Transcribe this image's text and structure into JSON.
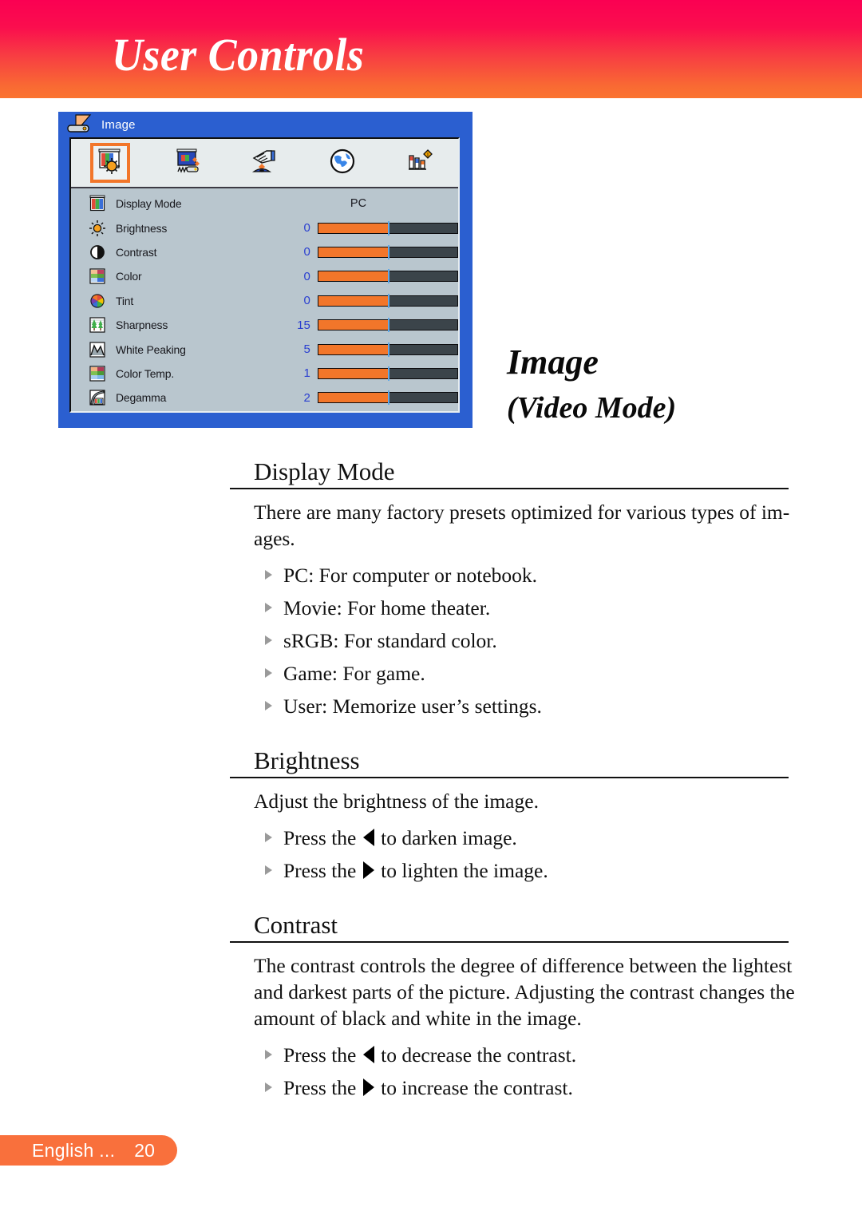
{
  "header": {
    "title": "User Controls",
    "gradient_top": "#fa0052",
    "gradient_bottom": "#fb7330"
  },
  "osd": {
    "window_title": "Image",
    "titlebar_icon": "projector-icon",
    "accent_color": "#f2762a",
    "frame_color": "#2b5fd0",
    "panel_color": "#b9c6ce",
    "tabs": [
      {
        "name": "image-tab",
        "icon": "image-screen-brightness-icon",
        "selected": true
      },
      {
        "name": "display-tab",
        "icon": "display-projector-icon",
        "selected": false
      },
      {
        "name": "setup-tab",
        "icon": "setup-hand-icon",
        "selected": false
      },
      {
        "name": "language-tab",
        "icon": "globe-icon",
        "selected": false
      },
      {
        "name": "options-tab",
        "icon": "bar-chart-info-icon",
        "selected": false
      }
    ],
    "rows": [
      {
        "icon": "rgb-bars-icon",
        "label": "Display Mode",
        "value_text": "PC",
        "has_slider": false
      },
      {
        "icon": "sun-icon",
        "label": "Brightness",
        "value": "0",
        "has_slider": true,
        "fill_percent": 50
      },
      {
        "icon": "contrast-icon",
        "label": "Contrast",
        "value": "0",
        "has_slider": true,
        "fill_percent": 50
      },
      {
        "icon": "color-swatch-icon",
        "label": "Color",
        "value": "0",
        "has_slider": true,
        "fill_percent": 50
      },
      {
        "icon": "color-wheel-icon",
        "label": "Tint",
        "value": "0",
        "has_slider": true,
        "fill_percent": 50
      },
      {
        "icon": "trees-icon",
        "label": "Sharpness",
        "value": "15",
        "has_slider": true,
        "fill_percent": 50
      },
      {
        "icon": "waveform-icon",
        "label": "White Peaking",
        "value": "5",
        "has_slider": true,
        "fill_percent": 50
      },
      {
        "icon": "color-temp-icon",
        "label": "Color Temp.",
        "value": "1",
        "has_slider": true,
        "fill_percent": 50
      },
      {
        "icon": "degamma-icon",
        "label": "Degamma",
        "value": "2",
        "has_slider": true,
        "fill_percent": 50
      }
    ]
  },
  "page": {
    "heading": "Image",
    "subheading": "(Video Mode)"
  },
  "sections": [
    {
      "heading": "Display Mode",
      "paragraph": "There are many factory presets optimized for various types of im-ages.",
      "bullets": [
        "PC: For computer or notebook.",
        "Movie: For home theater.",
        "sRGB: For standard color.",
        "Game: For game.",
        "User: Memorize user’s settings."
      ]
    },
    {
      "heading": "Brightness",
      "paragraph": "Adjust the brightness of the image.",
      "arrow_bullets": [
        {
          "prefix": "Press the",
          "arrow": "left",
          "suffix": "to darken image."
        },
        {
          "prefix": "Press the",
          "arrow": "right",
          "suffix": "to lighten the image."
        }
      ]
    },
    {
      "heading": "Contrast",
      "paragraph": "The contrast controls the degree of difference between the lightest and darkest parts of the picture. Adjusting the contrast changes the amount of black and white in the image.",
      "arrow_bullets": [
        {
          "prefix": "Press the",
          "arrow": "left",
          "suffix": "to decrease the contrast."
        },
        {
          "prefix": "Press the",
          "arrow": "right",
          "suffix": "to increase the contrast."
        }
      ]
    }
  ],
  "footer": {
    "language": "English ...",
    "page_number": "20",
    "pill_color": "#f9703c"
  }
}
